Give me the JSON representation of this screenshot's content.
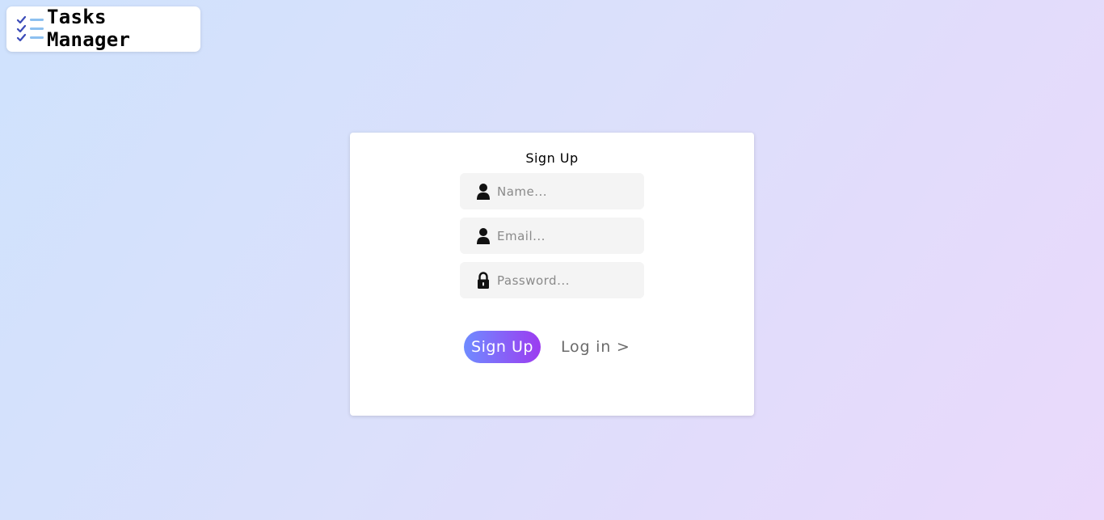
{
  "app": {
    "title": "Tasks Manager",
    "logo_icon": "checklist-icon"
  },
  "form": {
    "title": "Sign Up",
    "fields": [
      {
        "name": "name",
        "icon": "user-icon",
        "placeholder": "Name...",
        "value": ""
      },
      {
        "name": "email",
        "icon": "user-icon",
        "placeholder": "Email...",
        "value": ""
      },
      {
        "name": "password",
        "icon": "lock-icon",
        "placeholder": "Password...",
        "value": ""
      }
    ],
    "submit_label": "Sign Up",
    "login_link": "Log in >"
  },
  "colors": {
    "button_gradient_start": "#6f8bff",
    "button_gradient_end": "#9c3cf0",
    "logo_check": "#3b4bb8",
    "logo_lines": "#8cc0f0"
  }
}
